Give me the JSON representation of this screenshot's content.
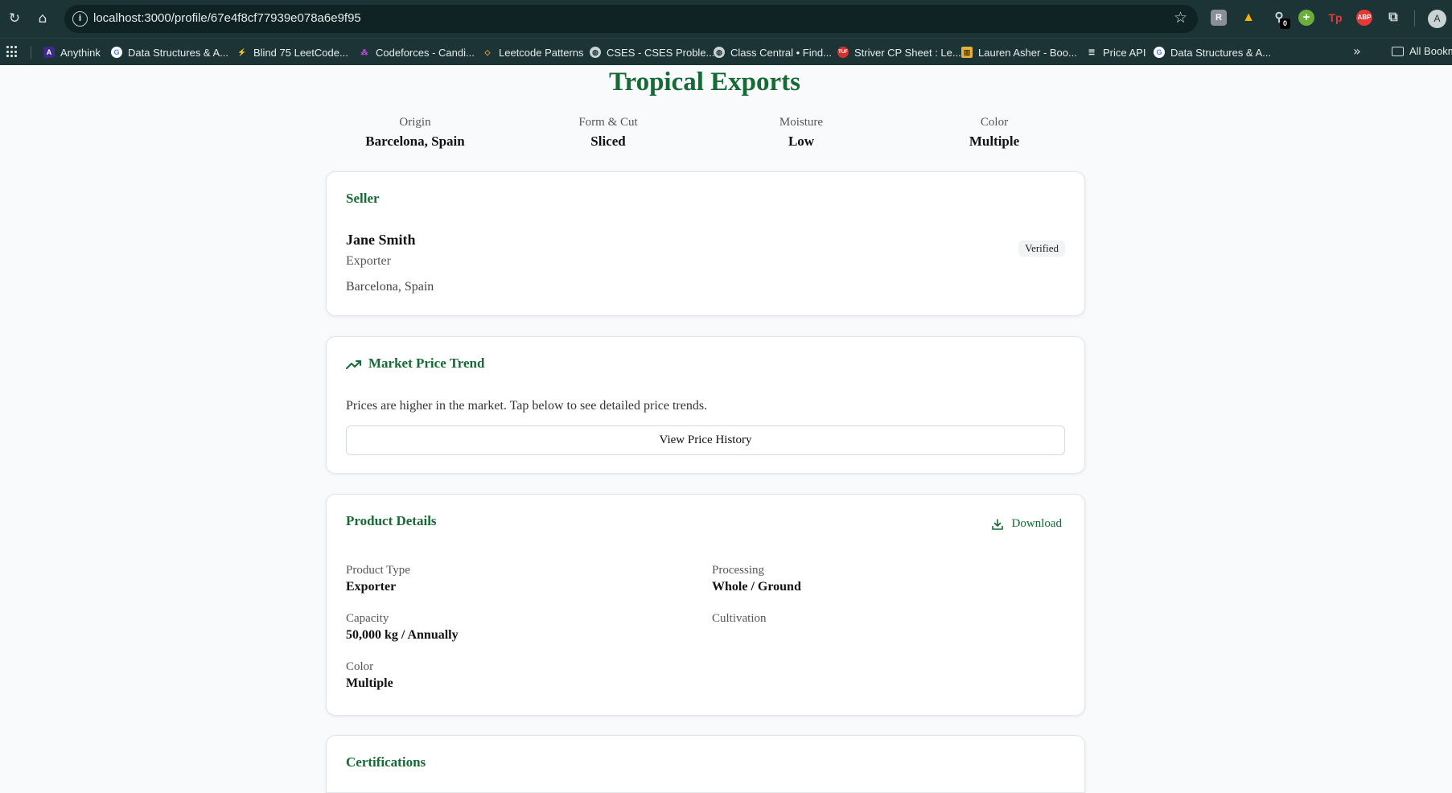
{
  "browser": {
    "url": "localhost:3000/profile/67e4f8cf77939e078a6e9f95",
    "avatar_letter": "A",
    "extension_badge": "0",
    "bookmarks": [
      {
        "label": "Anythink",
        "icon": "anythink-favicon"
      },
      {
        "label": "Data Structures & A...",
        "icon": "google-favicon"
      },
      {
        "label": "Blind 75 LeetCode...",
        "icon": "bolt-favicon"
      },
      {
        "label": "Codeforces - Candi...",
        "icon": "codeforces-favicon"
      },
      {
        "label": "Leetcode Patterns",
        "icon": "diamond-favicon"
      },
      {
        "label": "CSES - CSES Proble...",
        "icon": "globe-favicon"
      },
      {
        "label": "Class Central • Find...",
        "icon": "globe-favicon"
      },
      {
        "label": "Striver CP Sheet : Le...",
        "icon": "tuf-favicon"
      },
      {
        "label": "Lauren Asher - Boo...",
        "icon": "books-favicon"
      },
      {
        "label": "Price API",
        "icon": "flag-favicon"
      },
      {
        "label": "Data Structures & A...",
        "icon": "google-favicon"
      }
    ],
    "all_bookmarks_label": "All Bookm"
  },
  "page": {
    "title": "Tropical Exports",
    "stats": [
      {
        "label": "Origin",
        "value": "Barcelona, Spain"
      },
      {
        "label": "Form & Cut",
        "value": "Sliced"
      },
      {
        "label": "Moisture",
        "value": "Low"
      },
      {
        "label": "Color",
        "value": "Multiple"
      }
    ]
  },
  "seller": {
    "heading": "Seller",
    "name": "Jane Smith",
    "role": "Exporter",
    "location": "Barcelona, Spain",
    "badge": "Verified"
  },
  "market": {
    "heading": "Market Price Trend",
    "description": "Prices are higher in the market. Tap below to see detailed price trends.",
    "button_label": "View Price History"
  },
  "product": {
    "heading": "Product Details",
    "download_label": "Download",
    "details": [
      {
        "label": "Product Type",
        "value": "Exporter"
      },
      {
        "label": "Processing",
        "value": "Whole / Ground"
      },
      {
        "label": "Capacity",
        "value": "50,000 kg / Annually"
      },
      {
        "label": "Cultivation",
        "value": ""
      },
      {
        "label": "Color",
        "value": "Multiple"
      }
    ]
  },
  "certifications": {
    "heading": "Certifications"
  },
  "colors": {
    "brand_green": "#156a35",
    "chrome": "#1d3437"
  }
}
